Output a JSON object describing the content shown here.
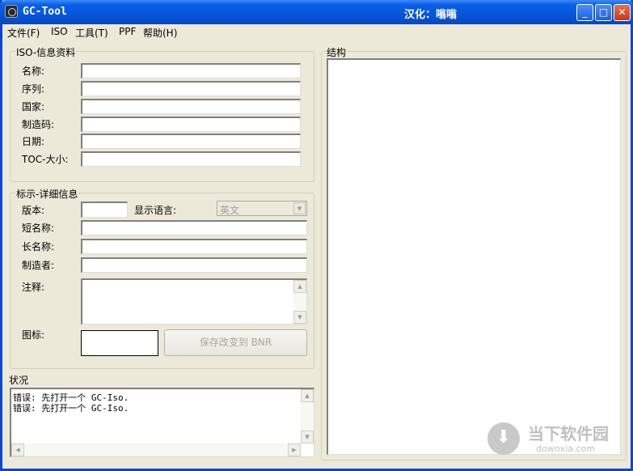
{
  "titlebar": {
    "app_title": "GC-Tool",
    "credit": "汉化：嗡嗡",
    "minimize_glyph": "_",
    "maximize_glyph": "□",
    "close_glyph": "✕"
  },
  "menu": [
    {
      "label": "文件(F)"
    },
    {
      "label": "ISO"
    },
    {
      "label": "工具(T)"
    },
    {
      "label": "PPF"
    },
    {
      "label": "帮助(H)"
    }
  ],
  "iso_info": {
    "legend": "ISO-信息资料",
    "fields": [
      {
        "label": "名称:",
        "value": ""
      },
      {
        "label": "序列:",
        "value": ""
      },
      {
        "label": "国家:",
        "value": ""
      },
      {
        "label": "制造码:",
        "value": ""
      },
      {
        "label": "日期:",
        "value": ""
      },
      {
        "label": "TOC-大小:",
        "value": ""
      }
    ]
  },
  "banner_info": {
    "legend": "标示-详细信息",
    "version_label": "版本:",
    "version_value": "",
    "language_label": "显示语言:",
    "language_selected": "英文",
    "short_name_label": "短名称:",
    "long_name_label": "长名称:",
    "maker_label": "制造者:",
    "comment_label": "注释:",
    "icon_label": "图标:",
    "save_button": "保存改变到 BNR"
  },
  "status": {
    "label": "状况",
    "lines": [
      "错误: 先打开一个 GC-Iso.",
      "错误: 先打开一个 GC-Iso."
    ]
  },
  "structure": {
    "label": "结构"
  },
  "watermark": {
    "brand": "当下软件园",
    "site": "downxia.com",
    "icon": "download-arrow-icon"
  },
  "icons": {
    "up": "▲",
    "down": "▼",
    "left": "◀",
    "right": "▶",
    "download": "⬇"
  }
}
